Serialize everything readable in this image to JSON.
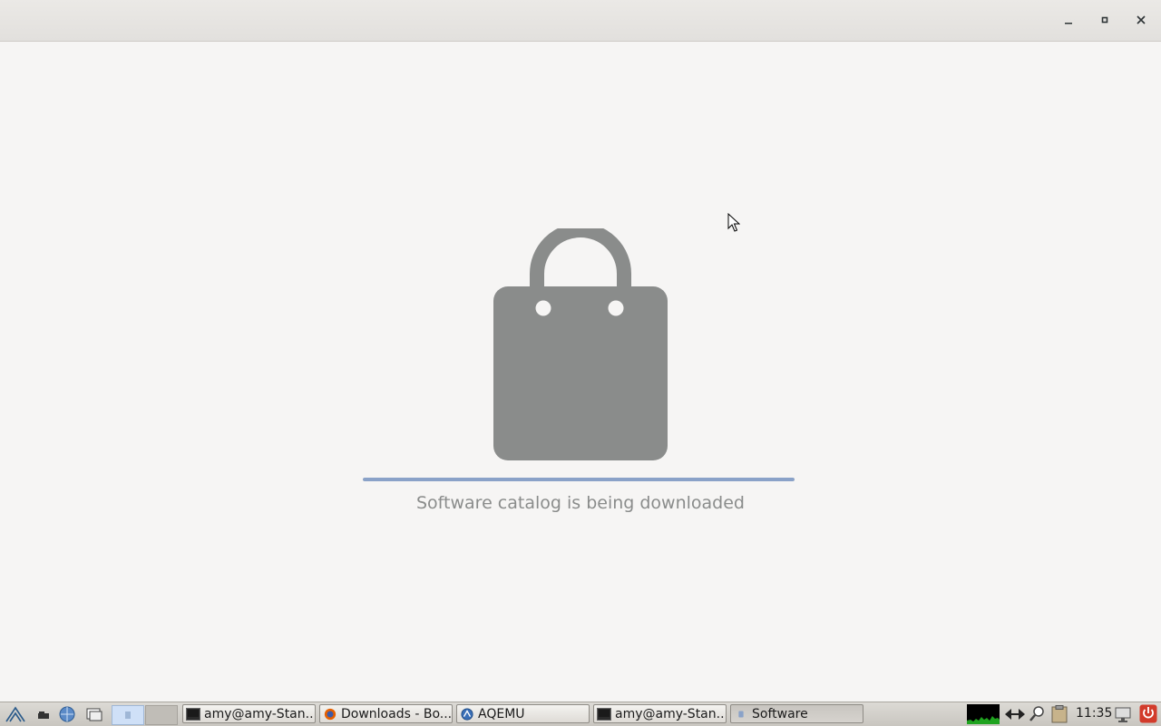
{
  "window": {
    "controls": {
      "minimize": "–",
      "maximize": "▫",
      "close": "✕"
    }
  },
  "main": {
    "status": "Software catalog is being downloaded",
    "progress": 1.0
  },
  "colors": {
    "icon": "#8a8c8b",
    "progress": "#8aa2c8"
  },
  "taskbar": {
    "tasks": [
      {
        "label": "amy@amy-Stan...",
        "icon": "terminal-icon"
      },
      {
        "label": "Downloads - Bo...",
        "icon": "firefox-icon"
      },
      {
        "label": "AQEMU",
        "icon": "aqemu-icon"
      },
      {
        "label": "amy@amy-Stan...",
        "icon": "terminal-icon"
      },
      {
        "label": "Software",
        "icon": "software-icon"
      }
    ],
    "clock": "11:35"
  }
}
